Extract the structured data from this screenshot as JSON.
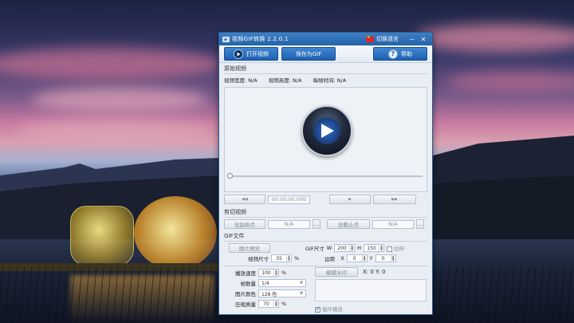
{
  "window": {
    "title": "视频GIF转换 2.2.0.1",
    "lang_switch": "切换语言",
    "minimize": "－",
    "close": "✕"
  },
  "toolbar": {
    "open_video": "打开视频",
    "save_gif": "保存为GIF",
    "help": "帮助"
  },
  "source": {
    "section": "原始视频",
    "width_label": "视频宽度: N/A",
    "height_label": "视频高度: N/A",
    "frame_time_label": "每帧时间: N/A"
  },
  "player": {
    "time": "00:00:00.000",
    "rewind_icon": "◀◀",
    "play_icon": "▶",
    "forward_icon": "▶▶"
  },
  "clip": {
    "section": "剪切视频",
    "set_start": "设起始点",
    "start_value": "N/A",
    "start_more": "...",
    "set_end": "设截止点",
    "end_value": "N/A",
    "end_more": "..."
  },
  "gif": {
    "section": "GIF文件",
    "preview_button": "图片预览",
    "size_label": "GIF尺寸",
    "w_label": "W",
    "w_value": "200",
    "h_label": "H",
    "h_value": "150",
    "stretch_label": "拉伸",
    "video_size_label": "视频尺寸",
    "video_size_value": "35",
    "percent": "%",
    "margin_label": "边距",
    "x_label": "X",
    "x_value": "0",
    "y_label": "Y",
    "y_value": "0",
    "speed_label": "播放速度",
    "speed_value": "100",
    "watermark_button": "编辑水印",
    "watermark_coords": "X: 0  Y: 0",
    "frames_label": "帧数量",
    "frames_value": "1/4",
    "colors_label": "图片颜色",
    "colors_value": "128 色",
    "quality_label": "压缩质量",
    "quality_value": "70",
    "loop_label": "循环播放"
  }
}
